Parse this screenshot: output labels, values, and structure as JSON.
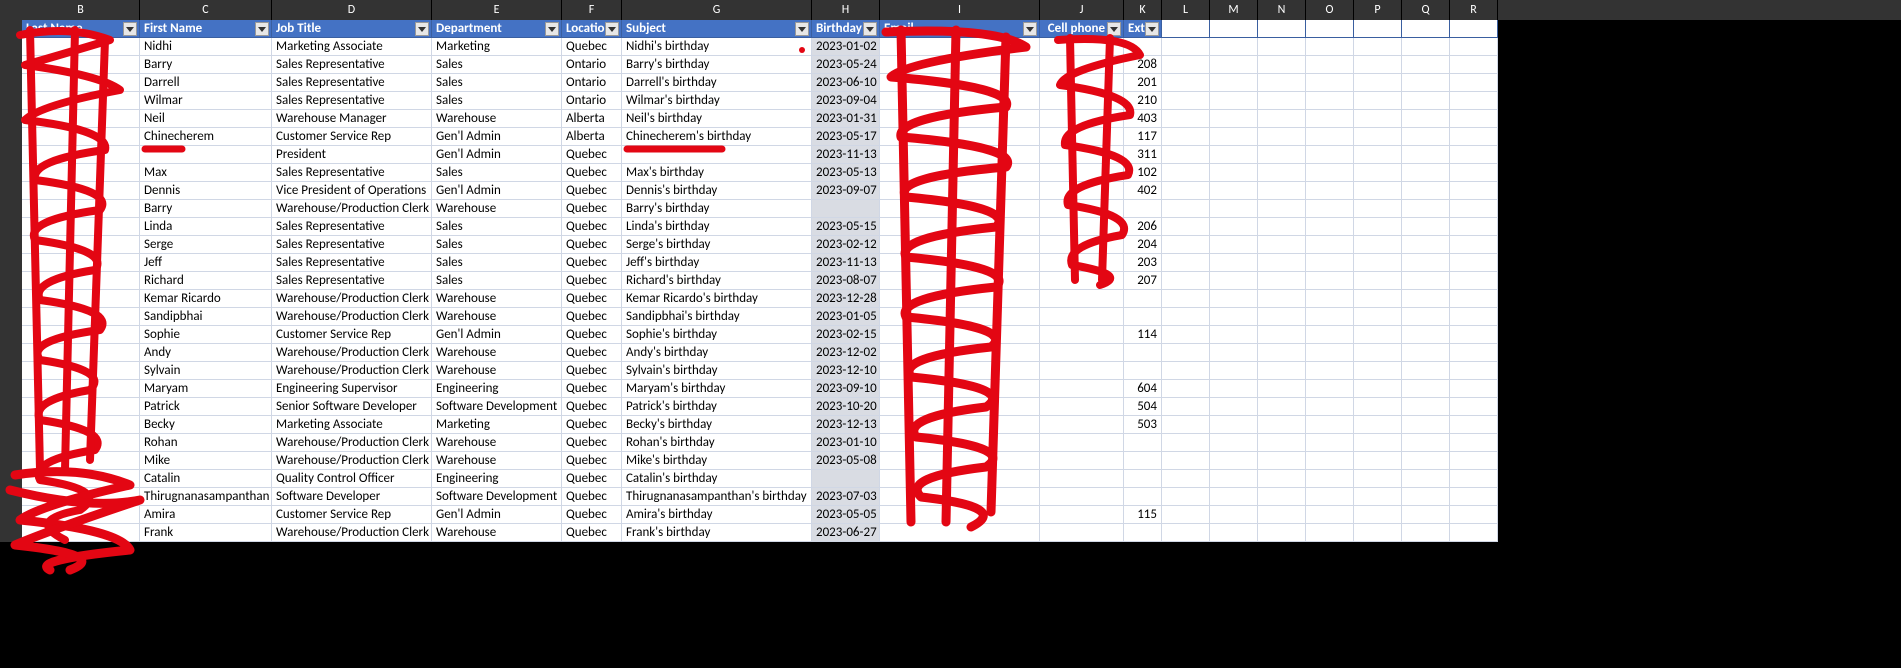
{
  "columns": {
    "letters": [
      "B",
      "C",
      "D",
      "E",
      "F",
      "G",
      "H",
      "I",
      "J",
      "K",
      "L",
      "M",
      "N",
      "O",
      "P",
      "Q",
      "R"
    ],
    "headers": [
      "Last Name",
      "First Name",
      "Job Title",
      "Department",
      "Location",
      "Subject",
      "Birthday",
      "Email",
      "Cell phone",
      "Ext"
    ]
  },
  "rows": [
    {
      "last": "",
      "first": "Nidhi",
      "job": "Marketing Associate",
      "dept": "Marketing",
      "loc": "Quebec",
      "subj": "Nidhi's birthday",
      "bday": "2023-01-02",
      "email": "",
      "cell": "",
      "ext": ""
    },
    {
      "last": "",
      "first": "Barry",
      "job": "Sales Representative",
      "dept": "Sales",
      "loc": "Ontario",
      "subj": "Barry's birthday",
      "bday": "2023-05-24",
      "email": "",
      "cell": "",
      "ext": "208"
    },
    {
      "last": "",
      "first": "Darrell",
      "job": "Sales Representative",
      "dept": "Sales",
      "loc": "Ontario",
      "subj": "Darrell's birthday",
      "bday": "2023-06-10",
      "email": "",
      "cell": "",
      "ext": "201"
    },
    {
      "last": "",
      "first": "Wilmar",
      "job": "Sales Representative",
      "dept": "Sales",
      "loc": "Ontario",
      "subj": "Wilmar's birthday",
      "bday": "2023-09-04",
      "email": "",
      "cell": "",
      "ext": "210"
    },
    {
      "last": "",
      "first": "Neil",
      "job": "Warehouse Manager",
      "dept": "Warehouse",
      "loc": "Alberta",
      "subj": "Neil's birthday",
      "bday": "2023-01-31",
      "email": "",
      "cell": "",
      "ext": "403"
    },
    {
      "last": "",
      "first": "Chinecherem",
      "job": "Customer Service Rep",
      "dept": "Gen'l Admin",
      "loc": "Alberta",
      "subj": "Chinecherem's birthday",
      "bday": "2023-05-17",
      "email": "",
      "cell": "",
      "ext": "117"
    },
    {
      "last": "",
      "first": "",
      "job": "President",
      "dept": "Gen'l Admin",
      "loc": "Quebec",
      "subj": "",
      "bday": "2023-11-13",
      "email": "",
      "cell": "",
      "ext": "311"
    },
    {
      "last": "",
      "first": "Max",
      "job": "Sales Representative",
      "dept": "Sales",
      "loc": "Quebec",
      "subj": "Max's birthday",
      "bday": "2023-05-13",
      "email": "",
      "cell": "",
      "ext": "102"
    },
    {
      "last": "",
      "first": "Dennis",
      "job": "Vice President of Operations",
      "dept": "Gen'l Admin",
      "loc": "Quebec",
      "subj": "Dennis's birthday",
      "bday": "2023-09-07",
      "email": "",
      "cell": "",
      "ext": "402"
    },
    {
      "last": "",
      "first": "Barry",
      "job": "Warehouse/Production Clerk",
      "dept": "Warehouse",
      "loc": "Quebec",
      "subj": "Barry's birthday",
      "bday": "",
      "email": "",
      "cell": "",
      "ext": ""
    },
    {
      "last": "",
      "first": "Linda",
      "job": "Sales Representative",
      "dept": "Sales",
      "loc": "Quebec",
      "subj": "Linda's birthday",
      "bday": "2023-05-15",
      "email": "",
      "cell": "",
      "ext": "206"
    },
    {
      "last": "",
      "first": "Serge",
      "job": "Sales Representative",
      "dept": "Sales",
      "loc": "Quebec",
      "subj": "Serge's birthday",
      "bday": "2023-02-12",
      "email": "",
      "cell": "",
      "ext": "204"
    },
    {
      "last": "",
      "first": "Jeff",
      "job": "Sales Representative",
      "dept": "Sales",
      "loc": "Quebec",
      "subj": "Jeff's birthday",
      "bday": "2023-11-13",
      "email": "",
      "cell": "",
      "ext": "203"
    },
    {
      "last": "",
      "first": "Richard",
      "job": "Sales Representative",
      "dept": "Sales",
      "loc": "Quebec",
      "subj": "Richard's birthday",
      "bday": "2023-08-07",
      "email": "",
      "cell": "",
      "ext": "207"
    },
    {
      "last": "",
      "first": "Kemar Ricardo",
      "job": "Warehouse/Production Clerk",
      "dept": "Warehouse",
      "loc": "Quebec",
      "subj": "Kemar Ricardo's birthday",
      "bday": "2023-12-28",
      "email": "",
      "cell": "",
      "ext": ""
    },
    {
      "last": "",
      "first": "Sandipbhai",
      "job": "Warehouse/Production Clerk",
      "dept": "Warehouse",
      "loc": "Quebec",
      "subj": "Sandipbhai's birthday",
      "bday": "2023-01-05",
      "email": "",
      "cell": "",
      "ext": ""
    },
    {
      "last": "",
      "first": "Sophie",
      "job": "Customer Service Rep",
      "dept": "Gen'l Admin",
      "loc": "Quebec",
      "subj": "Sophie's birthday",
      "bday": "2023-02-15",
      "email": "",
      "cell": "",
      "ext": "114"
    },
    {
      "last": "",
      "first": "Andy",
      "job": "Warehouse/Production Clerk",
      "dept": "Warehouse",
      "loc": "Quebec",
      "subj": "Andy's birthday",
      "bday": "2023-12-02",
      "email": "",
      "cell": "",
      "ext": ""
    },
    {
      "last": "",
      "first": "Sylvain",
      "job": "Warehouse/Production Clerk",
      "dept": "Warehouse",
      "loc": "Quebec",
      "subj": "Sylvain's birthday",
      "bday": "2023-12-10",
      "email": "",
      "cell": "",
      "ext": ""
    },
    {
      "last": "",
      "first": "Maryam",
      "job": "Engineering Supervisor",
      "dept": "Engineering",
      "loc": "Quebec",
      "subj": "Maryam's birthday",
      "bday": "2023-09-10",
      "email": "",
      "cell": "",
      "ext": "604"
    },
    {
      "last": "",
      "first": "Patrick",
      "job": "Senior Software Developer",
      "dept": "Software Development",
      "loc": "Quebec",
      "subj": "Patrick's birthday",
      "bday": "2023-10-20",
      "email": "",
      "cell": "",
      "ext": "504"
    },
    {
      "last": "",
      "first": "Becky",
      "job": "Marketing Associate",
      "dept": "Marketing",
      "loc": "Quebec",
      "subj": "Becky's birthday",
      "bday": "2023-12-13",
      "email": "",
      "cell": "",
      "ext": "503"
    },
    {
      "last": "",
      "first": "Rohan",
      "job": "Warehouse/Production Clerk",
      "dept": "Warehouse",
      "loc": "Quebec",
      "subj": "Rohan's birthday",
      "bday": "2023-01-10",
      "email": "",
      "cell": "",
      "ext": ""
    },
    {
      "last": "",
      "first": "Mike",
      "job": "Warehouse/Production Clerk",
      "dept": "Warehouse",
      "loc": "Quebec",
      "subj": "Mike's birthday",
      "bday": "2023-05-08",
      "email": "",
      "cell": "",
      "ext": ""
    },
    {
      "last": "",
      "first": "Catalin",
      "job": "Quality Control Officer",
      "dept": "Engineering",
      "loc": "Quebec",
      "subj": "Catalin's birthday",
      "bday": "",
      "email": "",
      "cell": "",
      "ext": ""
    },
    {
      "last": "",
      "first": "Thirugnanasampanthan",
      "job": "Software Developer",
      "dept": "Software Development",
      "loc": "Quebec",
      "subj": "Thirugnanasampanthan's birthday",
      "bday": "2023-07-03",
      "email": "",
      "cell": "",
      "ext": ""
    },
    {
      "last": "",
      "first": "Amira",
      "job": "Customer Service Rep",
      "dept": "Gen'l Admin",
      "loc": "Quebec",
      "subj": "Amira's birthday",
      "bday": "2023-05-05",
      "email": "",
      "cell": "",
      "ext": "115"
    },
    {
      "last": "",
      "first": "Frank",
      "job": "Warehouse/Production Clerk",
      "dept": "Warehouse",
      "loc": "Quebec",
      "subj": "Frank's birthday",
      "bday": "2023-06-27",
      "email": "",
      "cell": "",
      "ext": ""
    }
  ],
  "colors": {
    "header_bg": "#4472C4",
    "shade_bg": "#d9dce3",
    "scribble": "#e30613"
  }
}
